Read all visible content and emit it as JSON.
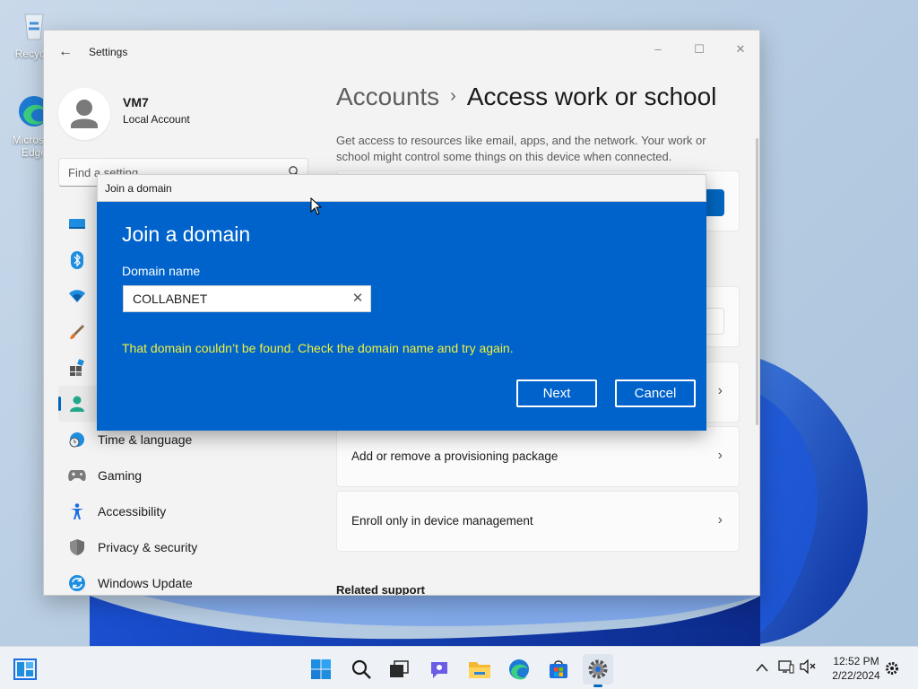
{
  "desktop": {
    "icons": [
      {
        "label": "Recycle"
      },
      {
        "label": "Microsoft Edge"
      }
    ]
  },
  "settings": {
    "title": "Settings",
    "window_controls": {
      "minimize": "–",
      "maximize": "☐",
      "close": "✕"
    },
    "back_glyph": "←",
    "user": {
      "name": "VM7",
      "account_type": "Local Account"
    },
    "search": {
      "placeholder": "Find a setting"
    },
    "nav": {
      "time_language": "Time & language",
      "gaming": "Gaming",
      "accessibility": "Accessibility",
      "privacy_security": "Privacy & security",
      "windows_update": "Windows Update"
    },
    "breadcrumb": {
      "parent": "Accounts",
      "separator": "›",
      "current": "Access work or school"
    },
    "description": "Get access to resources like email, apps, and the network. Your work or school might control some things on this device when connected.",
    "rows": {
      "provisioning": "Add or remove a provisioning package",
      "enroll": "Enroll only in device management"
    },
    "chevron": "›",
    "related_support": "Related support"
  },
  "dialog": {
    "title": "Join a domain",
    "heading": "Join a domain",
    "field_label": "Domain name",
    "field_value": "COLLABNET",
    "clear_glyph": "✕",
    "error": "That domain couldn’t be found. Check the domain name and try again.",
    "buttons": {
      "next": "Next",
      "cancel": "Cancel"
    }
  },
  "taskbar": {
    "clock": {
      "time": "12:52 PM",
      "date": "2/22/2024"
    }
  },
  "colors": {
    "accent": "#0067c0",
    "dialog_bg": "#0063cc",
    "error": "#f0f03a"
  }
}
